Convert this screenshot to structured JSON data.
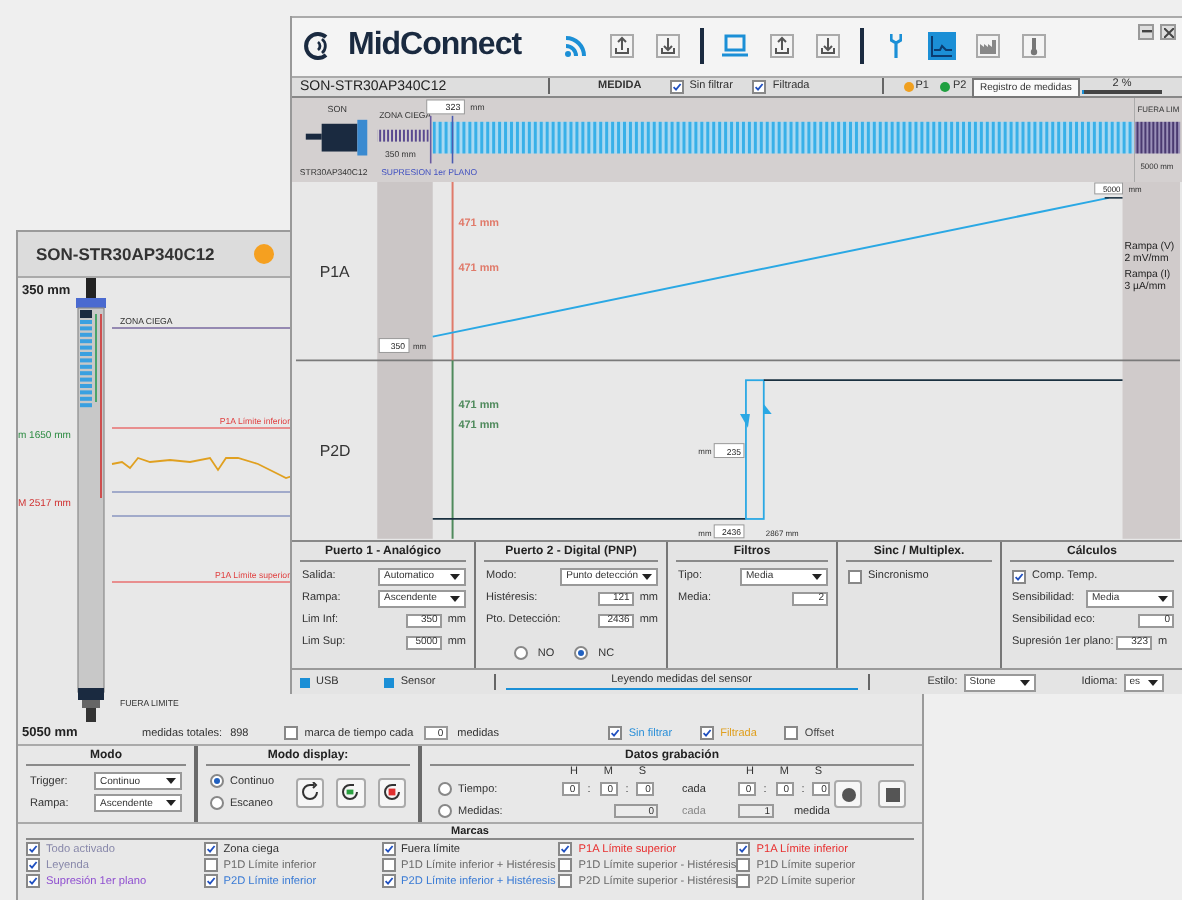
{
  "back_window": {
    "title": "SON-STR30AP340C12",
    "gauge": {
      "top_label": "350 mm",
      "min_label": "m 1650 mm",
      "max_label": "M 2517 mm",
      "bottom_label": "5050 mm"
    },
    "limit_lines": [
      {
        "kind": "blind",
        "label": "ZONA CIEGA"
      },
      {
        "kind": "p1a_lower",
        "label": "P1A Límite inferior"
      },
      {
        "kind": "p1a_upper",
        "label": "P1A Límite superior"
      },
      {
        "kind": "out",
        "label": "FUERA LIMITE"
      }
    ],
    "totals": {
      "label": "medidas totales:",
      "value": "898"
    },
    "timestamp": {
      "label": "marca de tiempo cada",
      "checked": false,
      "value": "0",
      "unit": "medidas"
    },
    "series_checks": [
      {
        "label": "Sin filtrar",
        "checked": true,
        "color": "#2a8fd8"
      },
      {
        "label": "Filtrada",
        "checked": true,
        "color": "#e0a020"
      },
      {
        "label": "Offset",
        "checked": false,
        "color": "#444444"
      }
    ],
    "modo": {
      "title": "Modo",
      "rows": [
        {
          "kind": "select",
          "label": "Trigger:",
          "value": "Continuo"
        },
        {
          "kind": "select",
          "label": "Rampa:",
          "value": "Ascendente"
        }
      ]
    },
    "modo_display": {
      "title": "Modo display:",
      "options": [
        {
          "label": "Continuo",
          "selected": true
        },
        {
          "label": "Escaneo",
          "selected": false
        }
      ]
    },
    "datos_grabacion": {
      "title": "Datos grabación",
      "hms_labels": [
        "H",
        "M",
        "S"
      ],
      "every_hms_labels": [
        "H",
        "M",
        "S"
      ],
      "tiempo": {
        "label": "Tiempo:",
        "selected": false,
        "values": [
          "0",
          "0",
          "0"
        ],
        "separators": [
          ":",
          ":"
        ],
        "every_label": "cada",
        "every_values": [
          "0",
          "0",
          "0"
        ],
        "every_separators": [
          ":",
          ":"
        ]
      },
      "medidas": {
        "label": "Medidas:",
        "selected": false,
        "value": "0",
        "every_label": "cada",
        "every_value": "1",
        "unit": "medida"
      }
    },
    "marcas": {
      "title": "Marcas",
      "items": [
        {
          "label": "Todo activado",
          "checked": true,
          "color": "#8888aa"
        },
        {
          "label": "Zona ciega",
          "checked": true,
          "color": "#333333"
        },
        {
          "label": "Fuera límite",
          "checked": true,
          "color": "#333333"
        },
        {
          "label": "P1A Límite superior",
          "checked": true,
          "color": "#e83030"
        },
        {
          "label": "P1A Límite inferior",
          "checked": true,
          "color": "#e83030"
        },
        {
          "label": "Leyenda",
          "checked": true,
          "color": "#8888aa"
        },
        {
          "label": "P1D Límite inferior",
          "checked": false,
          "color": "#6a6a6a"
        },
        {
          "label": "P1D Límite inferior + Histéresis",
          "checked": false,
          "color": "#6a6a6a"
        },
        {
          "label": "P1D Límite superior - Histéresis",
          "checked": false,
          "color": "#6a6a6a"
        },
        {
          "label": "P1D Límite superior",
          "checked": false,
          "color": "#6a6a6a"
        },
        {
          "label": "Supresión 1er plano",
          "checked": true,
          "color": "#9050d0"
        },
        {
          "label": "P2D Límite inferior",
          "checked": true,
          "color": "#3a7bd5"
        },
        {
          "label": "P2D Límite inferior + Histéresis",
          "checked": true,
          "color": "#3a7bd5"
        },
        {
          "label": "P2D Límite superior - Histéresis",
          "checked": false,
          "color": "#6a6a6a"
        },
        {
          "label": "P2D Límite superior",
          "checked": false,
          "color": "#6a6a6a"
        }
      ]
    }
  },
  "front_window": {
    "app_name": "MidConnect",
    "toolbar": [
      [
        {
          "kind": "wifi",
          "selected": false
        },
        {
          "kind": "upload",
          "selected": false
        },
        {
          "kind": "download",
          "selected": false
        }
      ],
      [
        {
          "kind": "laptop",
          "selected": false
        },
        {
          "kind": "upload",
          "selected": false
        },
        {
          "kind": "download",
          "selected": false
        }
      ],
      [
        {
          "kind": "wrench",
          "selected": false
        },
        {
          "kind": "chart",
          "selected": true
        },
        {
          "kind": "factory",
          "selected": false
        },
        {
          "kind": "thermometer",
          "selected": false
        }
      ]
    ],
    "device": "SON-STR30AP340C12",
    "mode": "MEDIDA",
    "filters": [
      {
        "label": "Sin filtrar",
        "checked": true
      },
      {
        "label": "Filtrada",
        "checked": true
      }
    ],
    "ports": [
      {
        "label": "P1",
        "color": "#f0a020"
      },
      {
        "label": "P2",
        "color": "#20a040"
      }
    ],
    "tooltip": "Registro de medidas",
    "progress": {
      "label": "2 %",
      "level": 0.02
    },
    "sensor": {
      "top_label": "SON",
      "model": "STR30AP340C12",
      "blind_label": "ZONA CIEGA",
      "blind_value": "350 mm",
      "suppression_value": "323",
      "suppression_unit": "mm",
      "suppression_label": "SUPRESION 1er PLANO",
      "out_label": "FUERA LIM",
      "out_value": "5000 mm"
    },
    "charts": [
      {
        "kind": "analog",
        "label": "P1A",
        "color": "#e07a6a",
        "markers": [
          "471 mm",
          "471 mm"
        ],
        "low_value": "350",
        "low_unit": "mm",
        "high_value": "5000",
        "high_unit": "mm",
        "notes": [
          "Rampa (V)",
          "2 mV/mm",
          "Rampa (I)",
          "3 µA/mm"
        ]
      },
      {
        "kind": "digital",
        "label": "P2D",
        "color": "#4f8a5c",
        "markers": [
          "471 mm",
          "471 mm"
        ],
        "hyst_unit": "mm",
        "hyst_value": "235",
        "point_unit": "mm",
        "point_value": "2436",
        "far_value": "2867 mm"
      }
    ],
    "panels": [
      {
        "title": "Puerto 1 - Analógico",
        "rows": [
          {
            "kind": "select",
            "label": "Salida:",
            "value": "Automatico"
          },
          {
            "kind": "select",
            "label": "Rampa:",
            "value": "Ascendente"
          },
          {
            "kind": "number",
            "label": "Lim Inf:",
            "value": "350",
            "unit": "mm"
          },
          {
            "kind": "number",
            "label": "Lim Sup:",
            "value": "5000",
            "unit": "mm"
          }
        ]
      },
      {
        "title": "Puerto 2 - Digital (PNP)",
        "rows": [
          {
            "kind": "select",
            "label": "Modo:",
            "value": "Punto detección"
          },
          {
            "kind": "number",
            "label": "Histéresis:",
            "value": "121",
            "unit": "mm"
          },
          {
            "kind": "number",
            "label": "Pto. Detección:",
            "value": "2436",
            "unit": "mm"
          },
          {
            "kind": "radios",
            "options": [
              {
                "label": "NO",
                "selected": false
              },
              {
                "label": "NC",
                "selected": true
              }
            ]
          }
        ]
      },
      {
        "title": "Filtros",
        "rows": [
          {
            "kind": "select",
            "label": "Tipo:",
            "value": "Media"
          },
          {
            "kind": "number",
            "label": "Media:",
            "value": "2"
          }
        ]
      },
      {
        "title": "Sinc / Multiplex.",
        "rows": [
          {
            "kind": "check",
            "label": "Sincronismo",
            "checked": false
          }
        ]
      },
      {
        "title": "Cálculos",
        "rows": [
          {
            "kind": "check",
            "label": "Comp. Temp.",
            "checked": true
          },
          {
            "kind": "select",
            "label": "Sensibilidad:",
            "value": "Media"
          },
          {
            "kind": "number",
            "label": "Sensibilidad eco:",
            "value": "0"
          },
          {
            "kind": "number",
            "label": "Supresión 1er plano:",
            "value": "323",
            "unit": "m"
          }
        ]
      }
    ],
    "status": {
      "usb": "USB",
      "sensor": "Sensor",
      "message": "Leyendo medidas del sensor",
      "level": 1,
      "estilo_label": "Estilo:",
      "estilo": "Stone",
      "idioma_label": "Idioma:",
      "idioma": "es"
    }
  }
}
